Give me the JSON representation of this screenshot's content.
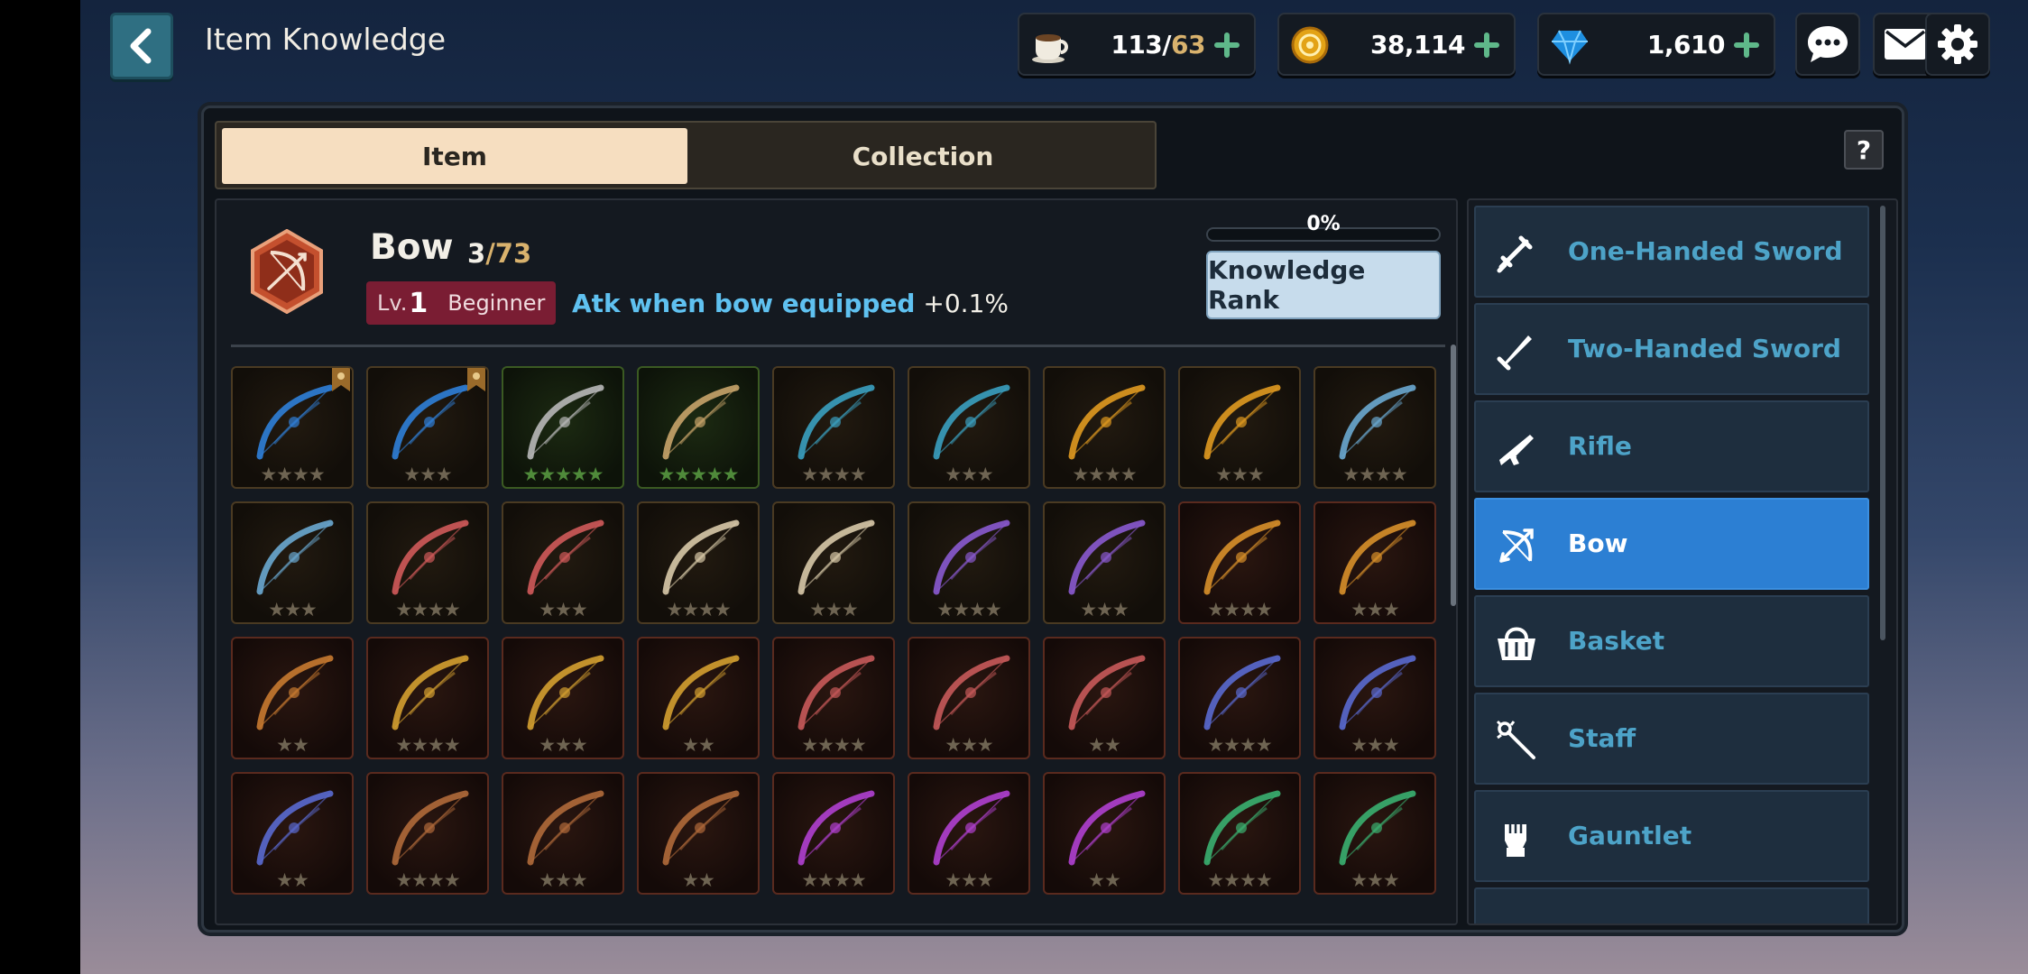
{
  "header": {
    "title": "Item Knowledge",
    "stamina": {
      "current": "113",
      "separator": "/",
      "max": "63"
    },
    "gold": "38,114",
    "gems": "1,610"
  },
  "tabs": [
    {
      "label": "Item",
      "active": true
    },
    {
      "label": "Collection",
      "active": false
    }
  ],
  "help_label": "?",
  "weapon": {
    "name": "Bow",
    "count": "3",
    "total": "/73",
    "level_prefix": "Lv.",
    "level": "1",
    "grade": "Beginner",
    "effect": "Atk when bow equipped",
    "effect_value": "+0.1%",
    "progress_label": "0%",
    "progress": 0,
    "rank_button": "Knowledge Rank"
  },
  "items": [
    {
      "stars": 4,
      "frame": "gold",
      "color": "#2f7fd8",
      "badge": true
    },
    {
      "stars": 3,
      "frame": "gold",
      "color": "#2f7fd8",
      "badge": true
    },
    {
      "stars": 5,
      "frame": "green",
      "color": "#b8b8b8",
      "badge": false
    },
    {
      "stars": 5,
      "frame": "green",
      "color": "#c8a46a",
      "badge": false
    },
    {
      "stars": 4,
      "frame": "gold",
      "color": "#3aa0c0",
      "badge": false
    },
    {
      "stars": 3,
      "frame": "gold",
      "color": "#3aa0c0",
      "badge": false
    },
    {
      "stars": 4,
      "frame": "gold",
      "color": "#e09a20",
      "badge": false
    },
    {
      "stars": 3,
      "frame": "gold",
      "color": "#e09a20",
      "badge": false
    },
    {
      "stars": 4,
      "frame": "gold",
      "color": "#6aa8d0",
      "badge": false
    },
    {
      "stars": 3,
      "frame": "gold",
      "color": "#6aa8d0",
      "badge": false
    },
    {
      "stars": 4,
      "frame": "gold",
      "color": "#d05a5a",
      "badge": false
    },
    {
      "stars": 3,
      "frame": "gold",
      "color": "#d05a5a",
      "badge": false
    },
    {
      "stars": 4,
      "frame": "gold",
      "color": "#d8c9a8",
      "badge": false
    },
    {
      "stars": 3,
      "frame": "gold",
      "color": "#d8c9a8",
      "badge": false
    },
    {
      "stars": 4,
      "frame": "gold",
      "color": "#8a5ad0",
      "badge": false
    },
    {
      "stars": 3,
      "frame": "gold",
      "color": "#8a5ad0",
      "badge": false
    },
    {
      "stars": 4,
      "frame": "red",
      "color": "#d8902a",
      "badge": false
    },
    {
      "stars": 3,
      "frame": "red",
      "color": "#d8902a",
      "badge": false
    },
    {
      "stars": 2,
      "frame": "red",
      "color": "#c87a30",
      "badge": false
    },
    {
      "stars": 4,
      "frame": "red",
      "color": "#d4a030",
      "badge": false
    },
    {
      "stars": 3,
      "frame": "red",
      "color": "#d4a030",
      "badge": false
    },
    {
      "stars": 2,
      "frame": "red",
      "color": "#d4a030",
      "badge": false
    },
    {
      "stars": 4,
      "frame": "red",
      "color": "#c85a5a",
      "badge": false
    },
    {
      "stars": 3,
      "frame": "red",
      "color": "#c85a5a",
      "badge": false
    },
    {
      "stars": 2,
      "frame": "red",
      "color": "#c85a5a",
      "badge": false
    },
    {
      "stars": 4,
      "frame": "red",
      "color": "#5a6ad0",
      "badge": false
    },
    {
      "stars": 3,
      "frame": "red",
      "color": "#5a6ad0",
      "badge": false
    },
    {
      "stars": 2,
      "frame": "red",
      "color": "#5a6ad0",
      "badge": false
    },
    {
      "stars": 4,
      "frame": "red",
      "color": "#b06a3a",
      "badge": false
    },
    {
      "stars": 3,
      "frame": "red",
      "color": "#b06a3a",
      "badge": false
    },
    {
      "stars": 2,
      "frame": "red",
      "color": "#b06a3a",
      "badge": false
    },
    {
      "stars": 4,
      "frame": "red",
      "color": "#b040d0",
      "badge": false
    },
    {
      "stars": 3,
      "frame": "red",
      "color": "#b040d0",
      "badge": false
    },
    {
      "stars": 2,
      "frame": "red",
      "color": "#b040d0",
      "badge": false
    },
    {
      "stars": 4,
      "frame": "red",
      "color": "#3ab070",
      "badge": false
    },
    {
      "stars": 3,
      "frame": "red",
      "color": "#3ab070",
      "badge": false
    }
  ],
  "categories": [
    {
      "label": "One-Handed Sword",
      "icon": "one-handed-sword-icon",
      "active": false
    },
    {
      "label": "Two-Handed Sword",
      "icon": "two-handed-sword-icon",
      "active": false
    },
    {
      "label": "Rifle",
      "icon": "rifle-icon",
      "active": false
    },
    {
      "label": "Bow",
      "icon": "bow-icon",
      "active": true
    },
    {
      "label": "Basket",
      "icon": "basket-icon",
      "active": false
    },
    {
      "label": "Staff",
      "icon": "staff-icon",
      "active": false
    },
    {
      "label": "Gauntlet",
      "icon": "gauntlet-icon",
      "active": false
    },
    {
      "label": "",
      "icon": "more-category-icon",
      "active": false
    }
  ],
  "colors": {
    "accent_blue": "#2c7fd3",
    "active_tab": "#f6dec0",
    "level_badge": "#7a1d33",
    "effect_text": "#5fc1f0",
    "gold_text": "#d9b26d",
    "plus_green": "#5fb88a"
  }
}
